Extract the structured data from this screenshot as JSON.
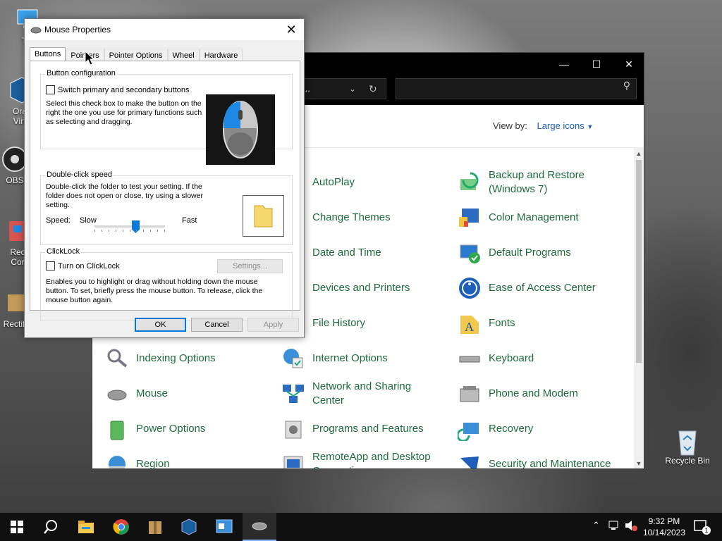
{
  "desktop": {
    "icons": [
      {
        "label": "Thi"
      },
      {
        "label": "Orac Virtu"
      },
      {
        "label": "OBS"
      },
      {
        "label": "Rec Cor"
      },
      {
        "label": "Rectify"
      },
      {
        "label": "Recycle Bin"
      }
    ]
  },
  "control_panel": {
    "view_by_label": "View by:",
    "view_by_value": "Large icons",
    "address_text": "...",
    "items": [
      {
        "label": "AutoPlay",
        "icon": "autoplay-icon"
      },
      {
        "label": "Backup and Restore (Windows 7)",
        "icon": "backup-icon"
      },
      {
        "label": "Change Themes",
        "icon": "themes-icon"
      },
      {
        "label": "Color Management",
        "icon": "color-management-icon"
      },
      {
        "label": "Date and Time",
        "icon": "date-time-icon"
      },
      {
        "label": "Default Programs",
        "icon": "default-programs-icon"
      },
      {
        "label": "Devices and Printers",
        "icon": "devices-icon"
      },
      {
        "label": "Ease of Access Center",
        "icon": "ease-of-access-icon"
      },
      {
        "label": "File History",
        "icon": "file-history-icon"
      },
      {
        "label": "Fonts",
        "icon": "fonts-icon"
      },
      {
        "label": "Indexing Options",
        "icon": "indexing-icon"
      },
      {
        "label": "Internet Options",
        "icon": "internet-options-icon"
      },
      {
        "label": "Keyboard",
        "icon": "keyboard-icon"
      },
      {
        "label": "Mouse",
        "icon": "mouse-icon"
      },
      {
        "label": "Network and Sharing Center",
        "icon": "network-icon"
      },
      {
        "label": "Phone and Modem",
        "icon": "phone-icon"
      },
      {
        "label": "Power Options",
        "icon": "power-icon"
      },
      {
        "label": "Programs and Features",
        "icon": "programs-icon"
      },
      {
        "label": "Recovery",
        "icon": "recovery-icon"
      },
      {
        "label": "Region",
        "icon": "region-icon"
      },
      {
        "label": "RemoteApp and Desktop Connections",
        "icon": "remoteapp-icon"
      },
      {
        "label": "Security and Maintenance",
        "icon": "security-icon"
      }
    ]
  },
  "dialog": {
    "title": "Mouse Properties",
    "tabs": [
      "Buttons",
      "Pointers",
      "Pointer Options",
      "Wheel",
      "Hardware"
    ],
    "active_tab": "Buttons",
    "button_config": {
      "title": "Button configuration",
      "checkbox_label": "Switch primary and secondary buttons",
      "checked": false,
      "description": "Select this check box to make the button on the right the one you use for primary functions such as selecting and dragging."
    },
    "double_click": {
      "title": "Double-click speed",
      "description": "Double-click the folder to test your setting. If the folder does not open or close, try using a slower setting.",
      "speed_label": "Speed:",
      "slow_label": "Slow",
      "fast_label": "Fast",
      "speed_value": 0.59
    },
    "clicklock": {
      "title": "ClickLock",
      "checkbox_label": "Turn on ClickLock",
      "checked": false,
      "settings_button": "Settings...",
      "description": "Enables you to highlight or drag without holding down the mouse button. To set, briefly press the mouse button. To release, click the mouse button again."
    },
    "buttons": {
      "ok": "OK",
      "cancel": "Cancel",
      "apply": "Apply"
    }
  },
  "taskbar": {
    "time": "9:32 PM",
    "date": "10/14/2023",
    "notification_count": "1"
  }
}
